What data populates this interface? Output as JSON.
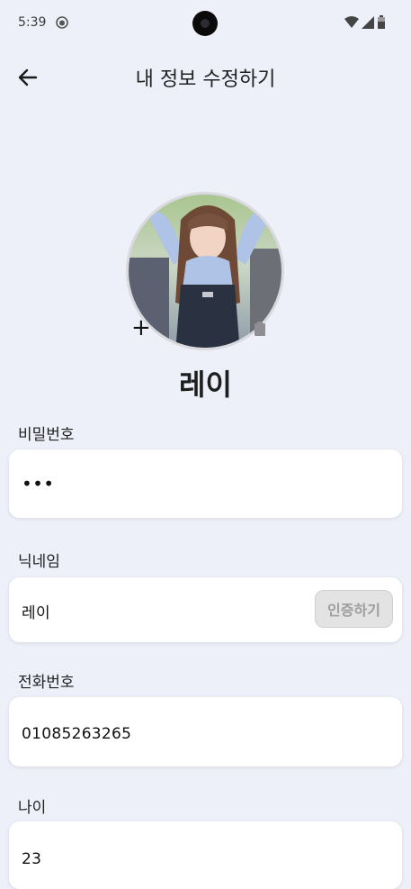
{
  "status_bar": {
    "time": "5:39",
    "app_icon": "github-icon",
    "wifi_icon": "wifi-icon",
    "signal_icon": "cell-signal-icon",
    "battery_icon": "battery-icon"
  },
  "header": {
    "back_icon": "arrow-left-icon",
    "title": "내 정보 수정하기"
  },
  "profile": {
    "add_icon": "plus",
    "add_symbol": "+",
    "delete_icon": "trash-icon",
    "name": "레이"
  },
  "fields": {
    "password": {
      "label": "비밀번호",
      "value": "•••"
    },
    "nickname": {
      "label": "닉네임",
      "value": "레이",
      "verify_label": "인증하기"
    },
    "phone": {
      "label": "전화번호",
      "value": "01085263265"
    },
    "age": {
      "label": "나이",
      "value": "23"
    }
  },
  "colors": {
    "background": "#eef0f9",
    "field_background": "#ffffff",
    "verify_button_background": "#e3e3e3",
    "verify_button_text": "#9e9e9e"
  }
}
